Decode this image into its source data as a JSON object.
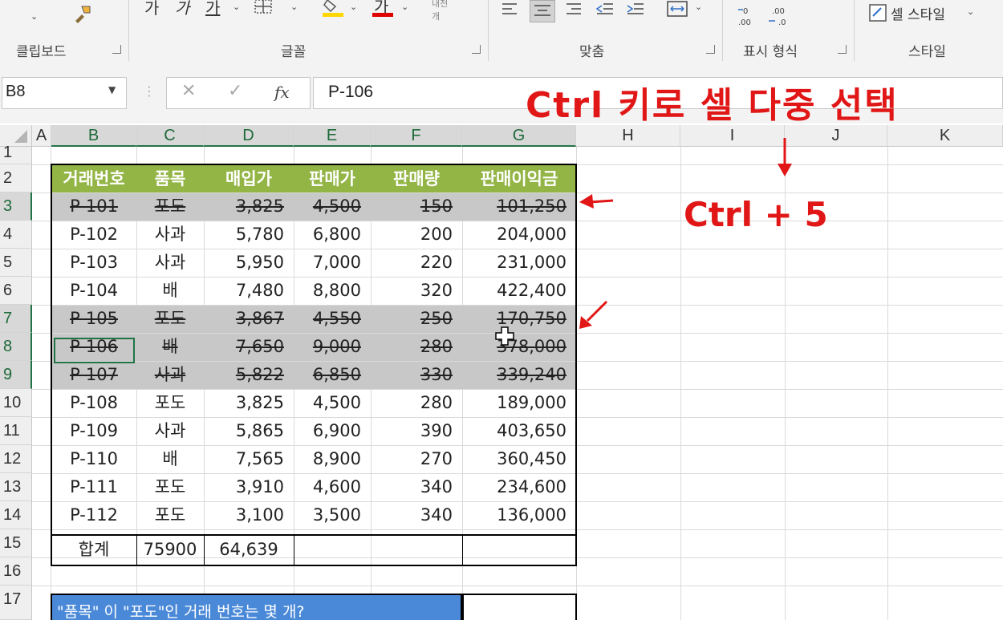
{
  "ribbon": {
    "groups": [
      {
        "label": "클립보드"
      },
      {
        "label": "글꼴"
      },
      {
        "label": "맞춤"
      },
      {
        "label": "표시 형식"
      },
      {
        "label": "스타일"
      }
    ],
    "cell_style_label": "셀 스타일",
    "font_increase": "가",
    "font_decrease": "가",
    "underline_glyph": "가",
    "font_color_glyph": "가",
    "accent_red": "#e00000",
    "accent_yellow": "#ffd700"
  },
  "formula_bar": {
    "name_box": "B8",
    "cancel": "✕",
    "enter": "✓",
    "fx": "fx",
    "formula": "P-106"
  },
  "columns": [
    "A",
    "B",
    "C",
    "D",
    "E",
    "F",
    "G",
    "H",
    "I",
    "J",
    "K"
  ],
  "rows": [
    "1",
    "2",
    "3",
    "4",
    "5",
    "6",
    "7",
    "8",
    "9",
    "10",
    "11",
    "12",
    "13",
    "14",
    "15",
    "16",
    "17"
  ],
  "table": {
    "headers": [
      "거래번호",
      "품목",
      "매입가",
      "판매가",
      "판매량",
      "판매이익금"
    ],
    "rows": [
      {
        "cells": [
          "P-101",
          "포도",
          "3,825",
          "4,500",
          "150",
          "101,250"
        ],
        "strike": true
      },
      {
        "cells": [
          "P-102",
          "사과",
          "5,780",
          "6,800",
          "200",
          "204,000"
        ],
        "strike": false
      },
      {
        "cells": [
          "P-103",
          "사과",
          "5,950",
          "7,000",
          "220",
          "231,000"
        ],
        "strike": false
      },
      {
        "cells": [
          "P-104",
          "배",
          "7,480",
          "8,800",
          "320",
          "422,400"
        ],
        "strike": false
      },
      {
        "cells": [
          "P-105",
          "포도",
          "3,867",
          "4,550",
          "250",
          "170,750"
        ],
        "strike": true
      },
      {
        "cells": [
          "P-106",
          "배",
          "7,650",
          "9,000",
          "280",
          "378,000"
        ],
        "strike": true
      },
      {
        "cells": [
          "P-107",
          "사과",
          "5,822",
          "6,850",
          "330",
          "339,240"
        ],
        "strike": true
      },
      {
        "cells": [
          "P-108",
          "포도",
          "3,825",
          "4,500",
          "280",
          "189,000"
        ],
        "strike": false
      },
      {
        "cells": [
          "P-109",
          "사과",
          "5,865",
          "6,900",
          "390",
          "403,650"
        ],
        "strike": false
      },
      {
        "cells": [
          "P-110",
          "배",
          "7,565",
          "8,900",
          "270",
          "360,450"
        ],
        "strike": false
      },
      {
        "cells": [
          "P-111",
          "포도",
          "3,910",
          "4,600",
          "340",
          "234,600"
        ],
        "strike": false
      },
      {
        "cells": [
          "P-112",
          "포도",
          "3,100",
          "3,500",
          "340",
          "136,000"
        ],
        "strike": false
      }
    ],
    "total": {
      "label": "합계",
      "c": "75900",
      "d": "64,639"
    },
    "header_color": "#93b546",
    "selection_color": "#c8c8c8"
  },
  "question": "\"품목\" 이 \"포도\"인 거래 번호는 몇 개?",
  "annotations": {
    "title": "Ctrl 키로 셀 다중 선택",
    "shortcut": "Ctrl + 5",
    "color": "#e11616"
  },
  "icons": {
    "paste": "paste-icon",
    "format_painter": "format-painter-icon",
    "borders": "borders-icon",
    "fill_color": "fill-color-icon",
    "font_color": "font-color-icon",
    "align": "align-icons",
    "decimal": "decimal-icons",
    "cell_style": "cell-style-icon",
    "fx": "fx-icon",
    "move_cursor": "move-cursor-icon"
  }
}
